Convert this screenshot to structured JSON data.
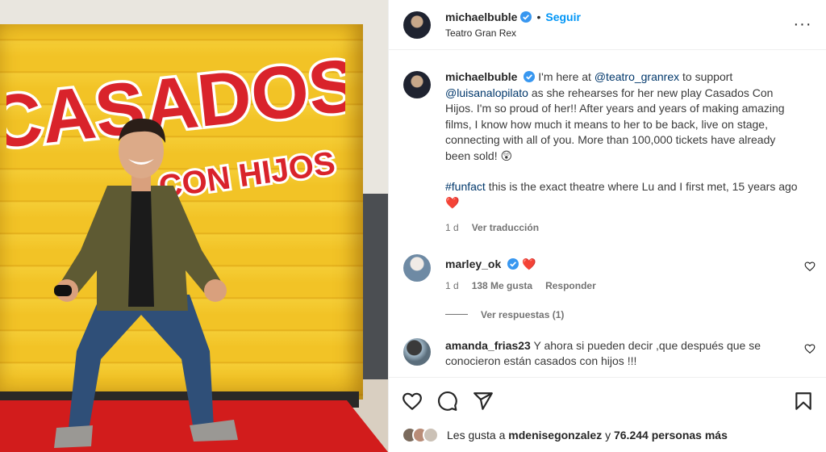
{
  "photo": {
    "logo_line1": "CASADOS",
    "logo_line2": "CON HIJOS"
  },
  "post_header": {
    "username": "michaelbuble",
    "separator": "•",
    "follow_label": "Seguir",
    "location": "Teatro Gran Rex",
    "more_icon": "···"
  },
  "caption": {
    "username": "michaelbuble",
    "p1_a": "I'm here at ",
    "mention1": "@teatro_granrex",
    "p1_b": " to support ",
    "mention2": "@luisanalopilato",
    "p1_c": " as she rehearses for her new play Casados Con Hijos. I'm so proud of her!! After years and years of making amazing films, I know how much it means to her to be back, live on stage, connecting with all of you. More than 100,000 tickets have already been sold! 😲",
    "hashtag": "#funfact",
    "p2": " this is the exact theatre where Lu and I first met, 15 years ago ❤️",
    "time": "1 d",
    "translate": "Ver traducción"
  },
  "comments": [
    {
      "username": "marley_ok",
      "text": " ❤️",
      "time": "1 d",
      "likes": "138 Me gusta",
      "reply": "Responder",
      "view_replies": "Ver respuestas (1)"
    },
    {
      "username": "amanda_frias23",
      "text": " Y ahora si pueden decir ,que después que se conocieron están casados con hijos !!!"
    }
  ],
  "likes": {
    "prefix": "Les gusta a ",
    "user": "mdenisegonzalez",
    "middle": " y ",
    "count": "76.244 personas más"
  },
  "colors": {
    "link_blue": "#0095f6",
    "mention_blue": "#00376b",
    "verified_blue": "#3897f0",
    "heart_red": "#ed4956"
  },
  "icons": [
    "verified-icon",
    "more-options-icon",
    "heart-icon",
    "comment-icon",
    "share-icon",
    "bookmark-icon"
  ]
}
